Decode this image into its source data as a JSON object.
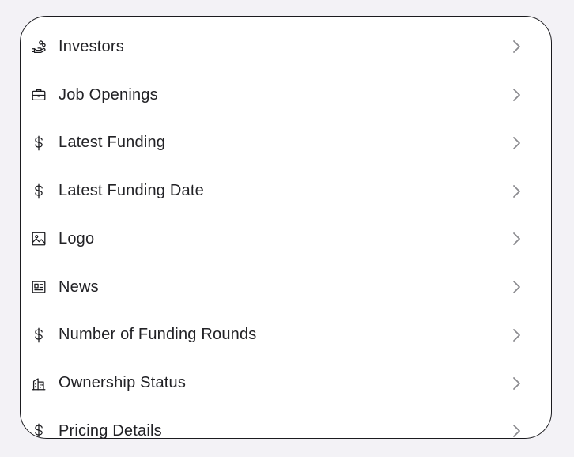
{
  "menu": {
    "items": [
      {
        "label": "Investors",
        "icon": "hand-coins-icon"
      },
      {
        "label": "Job Openings",
        "icon": "briefcase-icon"
      },
      {
        "label": "Latest Funding",
        "icon": "dollar-icon"
      },
      {
        "label": "Latest Funding Date",
        "icon": "dollar-icon"
      },
      {
        "label": "Logo",
        "icon": "image-icon"
      },
      {
        "label": "News",
        "icon": "newspaper-icon"
      },
      {
        "label": "Number of Funding Rounds",
        "icon": "dollar-icon"
      },
      {
        "label": "Ownership Status",
        "icon": "buildings-icon"
      },
      {
        "label": "Pricing Details",
        "icon": "dollar-icon"
      }
    ]
  },
  "colors": {
    "background": "#f3f2f6",
    "panel": "#ffffff",
    "border": "#1b1b1f",
    "text": "#222226",
    "chevron": "#8a8a8f"
  }
}
